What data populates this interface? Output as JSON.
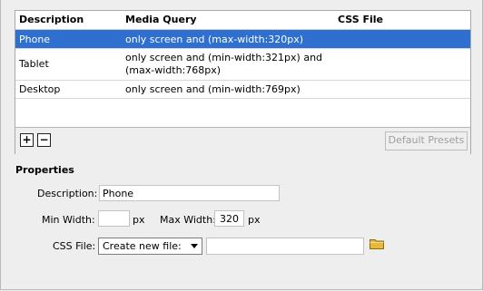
{
  "table": {
    "headers": {
      "description": "Description",
      "media_query": "Media Query",
      "css_file": "CSS File"
    },
    "rows": [
      {
        "description": "Phone",
        "media_query_line1": "only screen and (max-width:320px)",
        "media_query_line2": "",
        "css_file": ""
      },
      {
        "description": "Tablet",
        "media_query_line1": "only screen and (min-width:321px) and",
        "media_query_line2": "(max-width:768px)",
        "css_file": ""
      },
      {
        "description": "Desktop",
        "media_query_line1": "only screen and (min-width:769px)",
        "media_query_line2": "",
        "css_file": ""
      }
    ],
    "selected_row": "Phone",
    "add_symbol": "+",
    "remove_symbol": "−",
    "default_presets_label": "Default Presets"
  },
  "properties": {
    "heading": "Properties",
    "description_label": "Description:",
    "description_value": "Phone",
    "min_width_label": "Min Width:",
    "min_width_value": "",
    "min_width_unit": "px",
    "max_width_label": "Max Width:",
    "max_width_value": "320",
    "max_width_unit": "px",
    "css_file_label": "CSS File:",
    "css_file_option": "Create new file:",
    "css_file_path": "",
    "folder_icon": "folder-icon"
  },
  "colors": {
    "selection": "#2f6fd0",
    "folder": "#e6b93b"
  }
}
